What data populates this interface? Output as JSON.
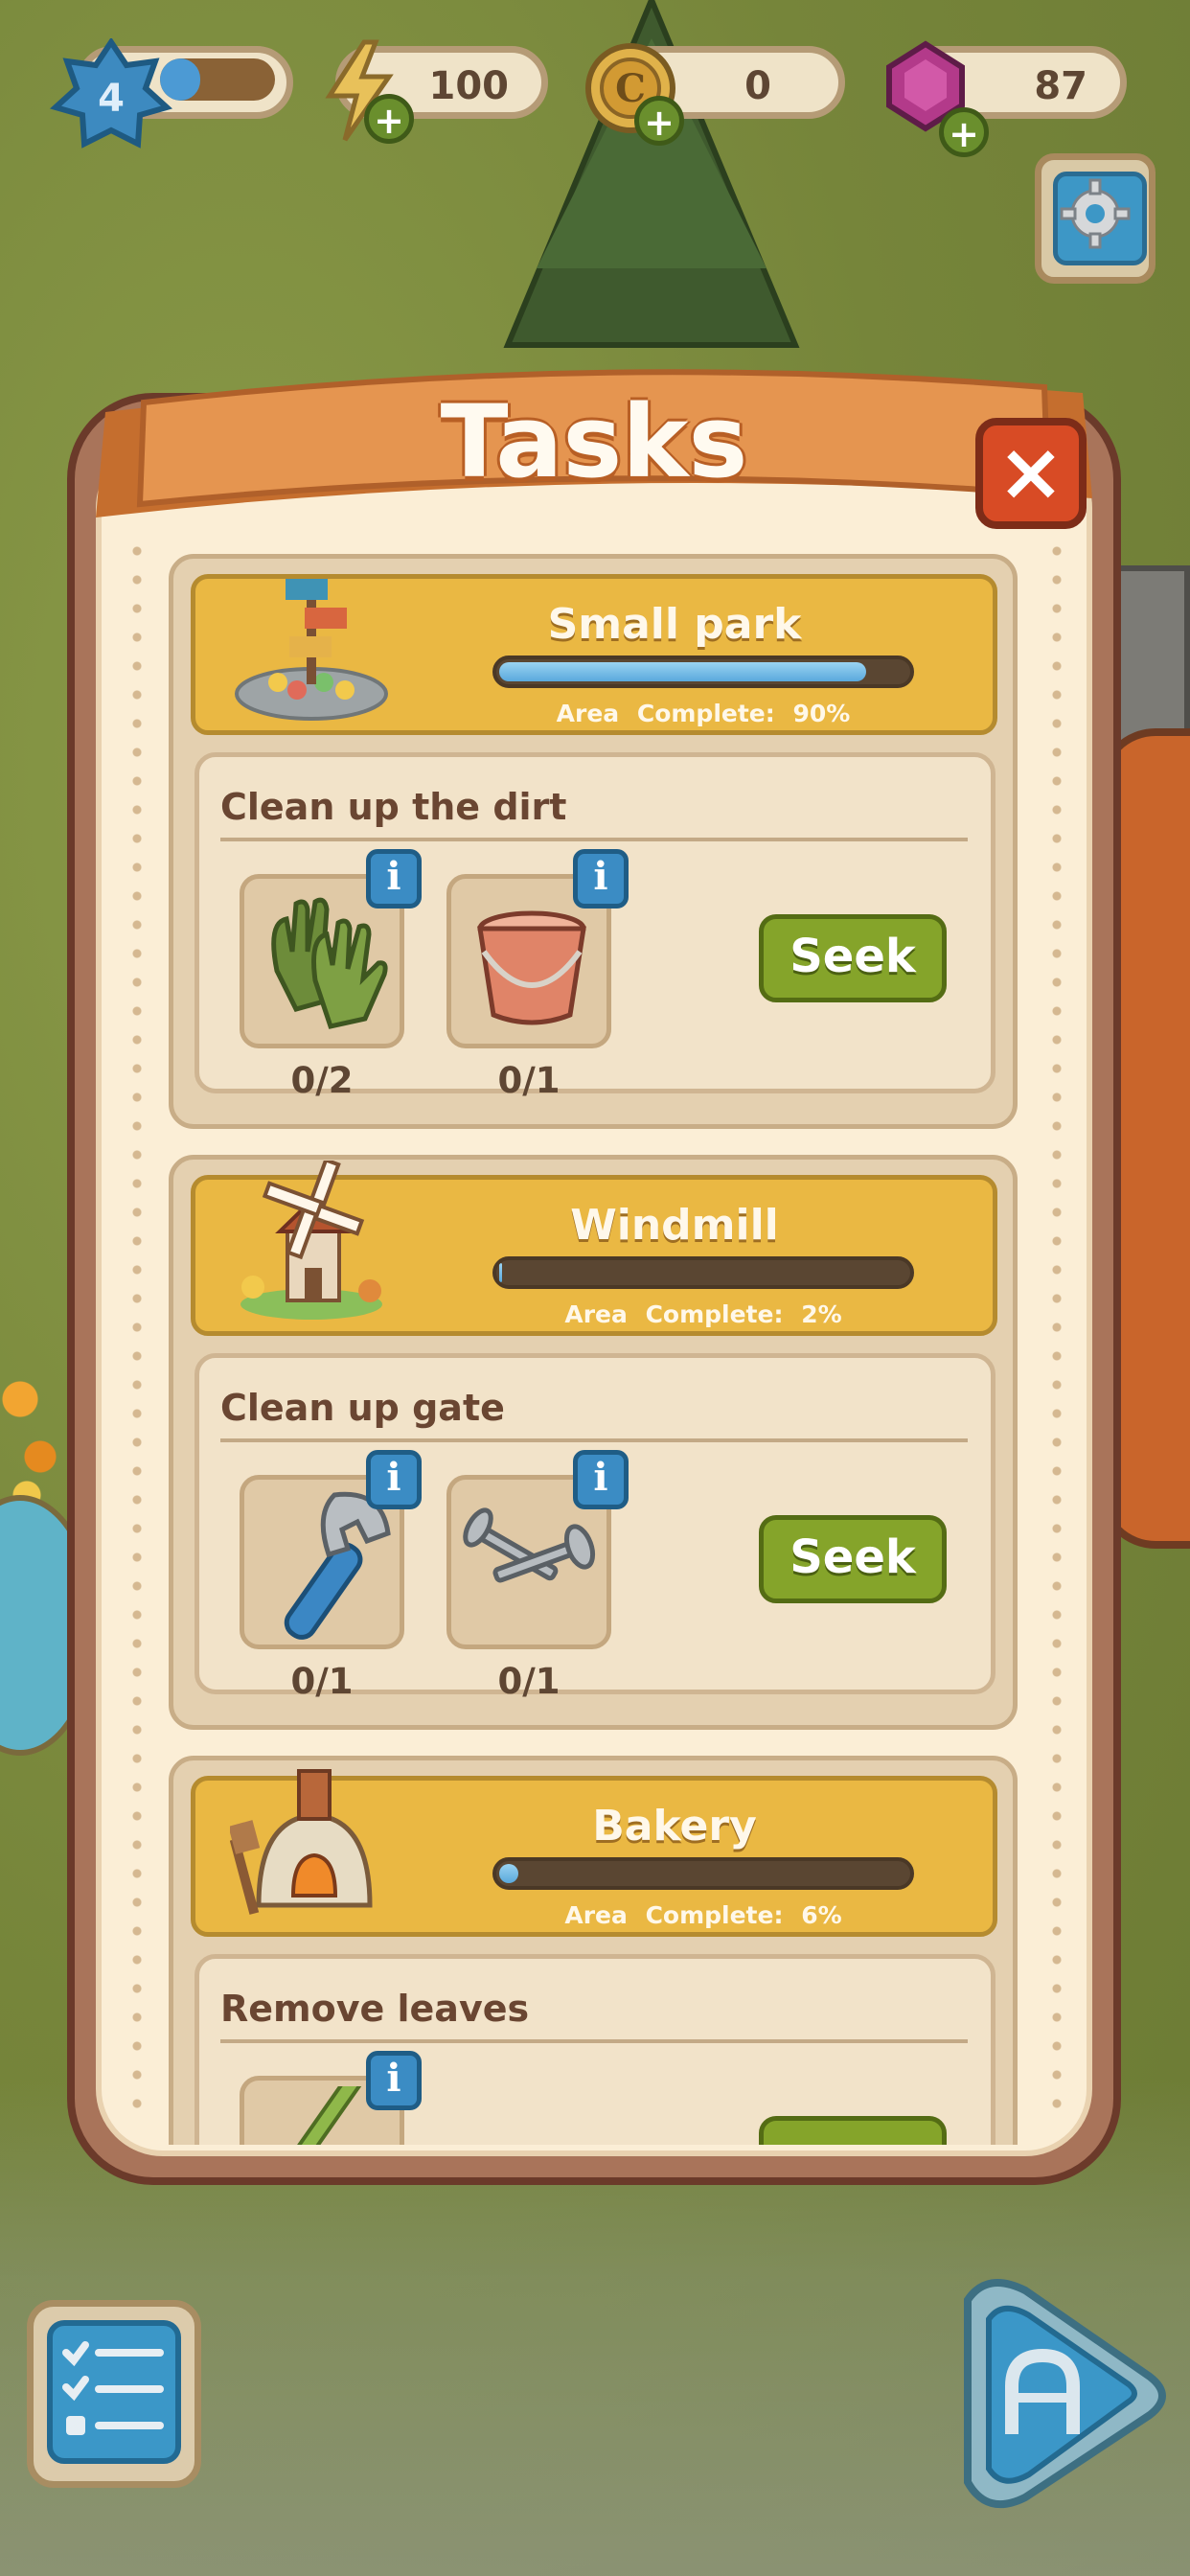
{
  "hud": {
    "level": "4",
    "level_progress": 0.35,
    "energy": "100",
    "coins": "0",
    "gems": "87",
    "plus_label": "+"
  },
  "panel": {
    "title": "Tasks",
    "close_label": "×"
  },
  "areas": [
    {
      "name": "Small park",
      "complete_label": "Area Complete:",
      "complete_value": "90%",
      "progress": 0.9,
      "thumb_icon": "small-park-icon",
      "task": {
        "title": "Clean up the dirt",
        "items": [
          {
            "icon": "gloves-icon",
            "count": "0/2"
          },
          {
            "icon": "bucket-icon",
            "count": "0/1"
          }
        ],
        "seek_label": "Seek"
      }
    },
    {
      "name": "Windmill",
      "complete_label": "Area Complete:",
      "complete_value": "2%",
      "progress": 0.02,
      "thumb_icon": "windmill-icon",
      "task": {
        "title": "Clean up gate",
        "items": [
          {
            "icon": "wrench-icon",
            "count": "0/1"
          },
          {
            "icon": "nails-icon",
            "count": "0/1"
          }
        ],
        "seek_label": "Seek"
      }
    },
    {
      "name": "Bakery",
      "complete_label": "Area Complete:",
      "complete_value": "6%",
      "progress": 0.06,
      "thumb_icon": "bakery-oven-icon",
      "task": {
        "title": "Remove leaves",
        "items": [
          {
            "icon": "rake-icon",
            "count": ""
          }
        ],
        "seek_label": ""
      }
    }
  ],
  "info_label": "i",
  "colors": {
    "accent_gold": "#eab843",
    "progress_blue": "#5aa9dc",
    "seek_green": "#85a42a",
    "close_red": "#d84b25"
  }
}
